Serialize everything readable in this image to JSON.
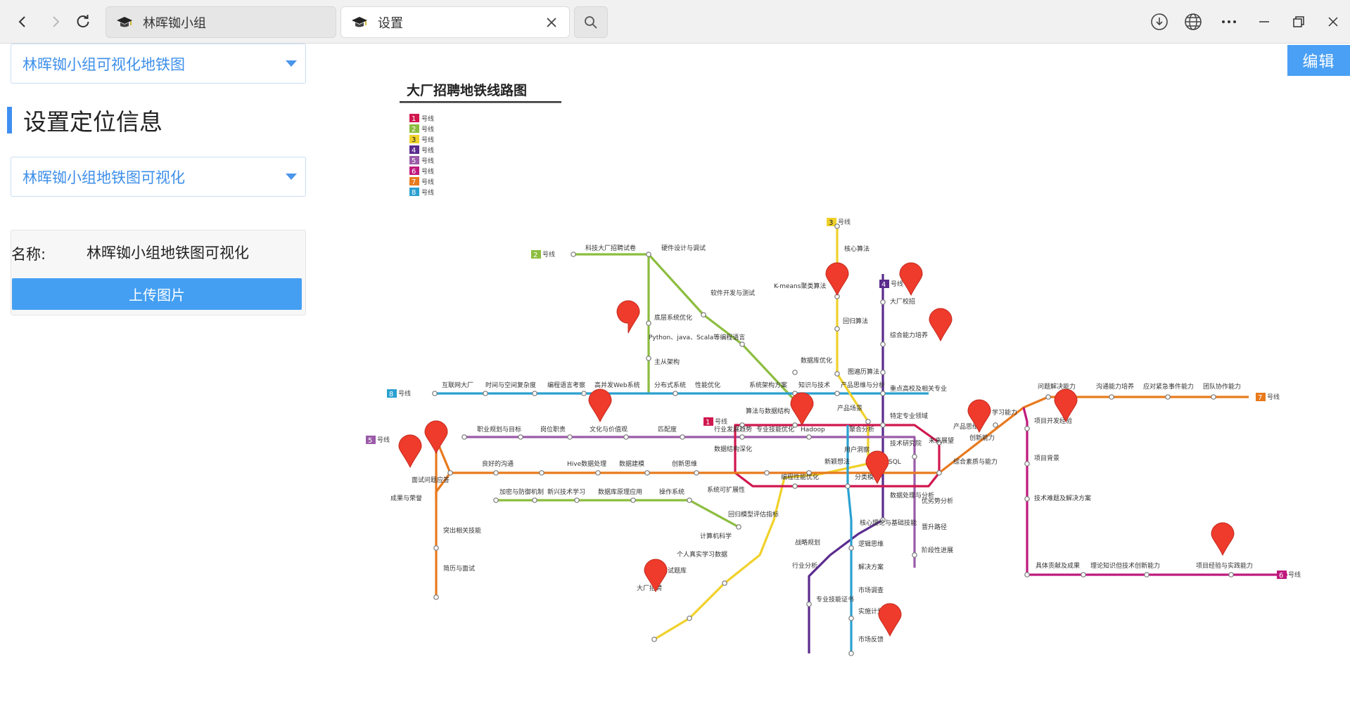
{
  "browser": {
    "tabs": [
      {
        "title": "林晖铷小组",
        "icon": "graduation-cap-icon"
      },
      {
        "title": "设置",
        "icon": "graduation-cap-icon"
      }
    ]
  },
  "toolbar": {
    "edit_label": "编辑"
  },
  "sidebar": {
    "map_select": "林晖铷小组可视化地铁图",
    "section_title": "设置定位信息",
    "location_select": "林晖铷小组地铁图可视化",
    "name_label": "名称:",
    "name_value": "林晖铷小组地铁图可视化",
    "upload_label": "上传图片"
  },
  "metro_map": {
    "title": "大厂招聘地铁线路图",
    "line_suffix": "号线",
    "colors": {
      "1": "#d0174e",
      "2": "#8cbd3f",
      "3": "#f0d12a",
      "4": "#5a2b8d",
      "5": "#9a5ba8",
      "6": "#c0197d",
      "7": "#e87a1e",
      "8": "#2aa0d0"
    },
    "legend": [
      {
        "num": "1",
        "label": "号线"
      },
      {
        "num": "2",
        "label": "号线"
      },
      {
        "num": "3",
        "label": "号线"
      },
      {
        "num": "4",
        "label": "号线"
      },
      {
        "num": "5",
        "label": "号线"
      },
      {
        "num": "6",
        "label": "号线"
      },
      {
        "num": "7",
        "label": "号线"
      },
      {
        "num": "8",
        "label": "号线"
      }
    ],
    "station_labels": {
      "l2_a": "科技大厂招聘试卷",
      "l2_b": "硬件设计与调试",
      "l2_c": "软件开发与测试",
      "l2_d": "底层系统优化",
      "l2_e": "Python、java、Scala等编程语言",
      "l2_f": "主从架构",
      "l2_g": "数据库优化",
      "l3_a": "核心算法",
      "l3_b": "K-means聚类算法",
      "l3_c": "回归算法",
      "l3_d": "图遍历算法",
      "l3_e": "产品场景",
      "l4_a": "大厂校招",
      "l4_b": "综合能力培养",
      "l4_c": "重点高校及相关专业",
      "l4_d": "特定专业领域",
      "l8_a": "互联网大厂",
      "l8_b": "时间与空间复杂度",
      "l8_c": "编程语言考察",
      "l8_d": "高并发Web系统",
      "l8_e": "分布式系统",
      "l8_f": "性能优化",
      "l8_g": "系统架构方案",
      "l8_h": "知识与技术",
      "l8_i": "产品思维与分析",
      "l5_a": "职业规划与目标",
      "l5_b": "岗位职责",
      "l5_c": "文化与价值观",
      "l5_d": "匹配度",
      "l5_e": "行业发展趋势",
      "l5_f": "专业技能优化",
      "l5_g": "Hadoop",
      "l5_h": "聚合分析",
      "l1_a": "算法与数据结构",
      "l1_b": "数据结构深化",
      "l1_c": "编程性能优化",
      "l1_d": "分类模型",
      "l1_e": "SQL",
      "l1_f": "未来展望",
      "l1_g": "技术研究院",
      "l1_h": "用户洞察",
      "l1_i": "新颖想法",
      "l7_a": "问题解决能力",
      "l7_b": "沟通能力培养",
      "l7_c": "应对紧急事件能力",
      "l7_d": "团队协作能力",
      "l7_e": "学习能力",
      "l7_f": "产品思维",
      "l7_g": "创新能力",
      "l7_h": "综合素质与能力",
      "l7_i": "面试问题应答",
      "l7_j": "良好的沟通",
      "l7_k": "Hive数据处理",
      "l7_l": "数据建模",
      "l7_m": "创新思维",
      "l7_n": "成果与荣誉",
      "l7_o": "突出相关技能",
      "l7_p": "简历与面试",
      "l6_a": "项目开发经验",
      "l6_b": "项目背景",
      "l6_c": "技术难题及解决方案",
      "l6_d": "具体贡献及成果",
      "l6_e": "理论知识但技术创新能力",
      "l6_f": "项目经验与实践能力",
      "l3b_a": "加密与防御机制",
      "l3b_b": "新兴技术学习",
      "l3b_c": "数据库原理应用",
      "l3b_d": "操作系统",
      "l3b_e": "系统可扩展性",
      "l3b_f": "回归模型评估指标",
      "l3b_g": "计算机科学",
      "l3b_h": "个人真实学习数据",
      "l3b_i": "面试题库",
      "l3b_j": "大厂招聘",
      "l4b_a": "数据处理与分析",
      "l4b_b": "优劣势分析",
      "l4b_c": "晋升路径",
      "l4b_d": "阶段性进展",
      "l4b_e": "核心理论与基础技能",
      "l8b_a": "战略规划",
      "l8b_b": "行业分析",
      "l8b_c": "专业技能证书",
      "l8b_d": "逻辑思维",
      "l8b_e": "解决方案",
      "l8b_f": "市场调查",
      "l8b_g": "实施计划",
      "l8b_h": "市场反馈"
    }
  }
}
